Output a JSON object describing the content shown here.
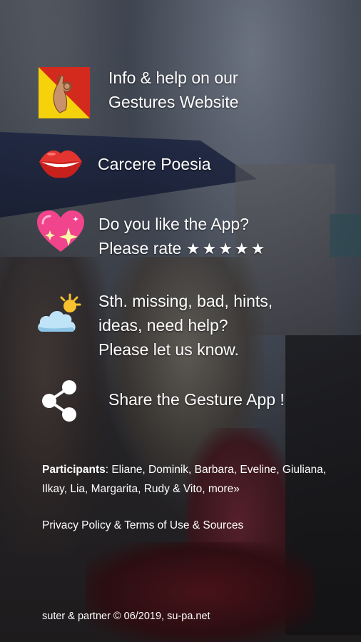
{
  "menu": {
    "info": {
      "line1": "Info & help on our",
      "line2": "Gestures Website",
      "icon": "sicily-flag-gesture-icon"
    },
    "carcere": {
      "label": "Carcere Poesia",
      "icon": "lips-icon"
    },
    "rate": {
      "line1": "Do you like the App?",
      "line2_prefix": "Please rate",
      "stars": "★★★★★",
      "icon": "sparkling-heart-icon"
    },
    "feedback": {
      "line1": "Sth. missing, bad, hints,",
      "line2": "ideas, need help?",
      "line3": "Please let us know.",
      "icon": "sun-behind-cloud-icon"
    },
    "share": {
      "label": "Share the Gesture App !",
      "icon": "share-icon"
    }
  },
  "participants": {
    "label": "Participants",
    "names": ": Eliane, Dominik, Barbara, Eveline, Giuliana, Ilkay, Lia, Margarita, Rudy & Vito, more»"
  },
  "footer": {
    "privacy": "Privacy Policy & Terms of Use & Sources",
    "copyright": "suter & partner © 06/2019, su-pa.net"
  },
  "colors": {
    "flag_red": "#d42a1e",
    "flag_yellow": "#f5d20c",
    "lips_red": "#e3342f",
    "heart_pink": "#f0448c",
    "text": "#ffffff"
  }
}
